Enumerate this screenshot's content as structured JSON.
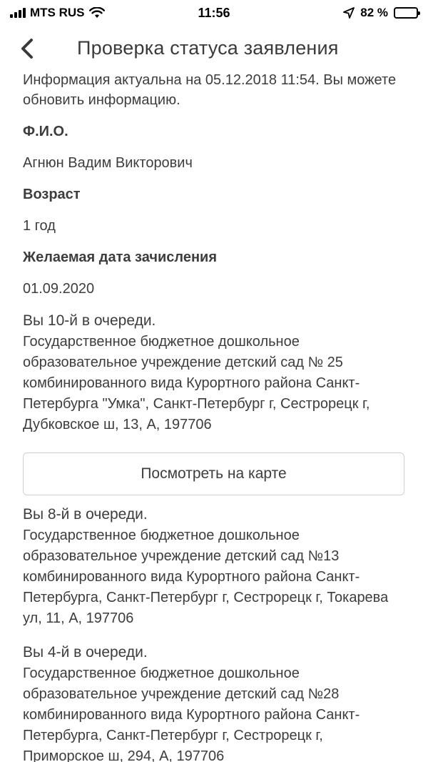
{
  "status_bar": {
    "carrier": "MTS RUS",
    "time": "11:56",
    "battery_percent": "82 %",
    "battery_level": 0.82
  },
  "header": {
    "title": "Проверка статуса заявления"
  },
  "info": {
    "text": "Информация актуальна на 05.12.2018 11:54. Вы можете обновить информацию."
  },
  "fields": [
    {
      "label": "Ф.И.О.",
      "value": "Агнюн Вадим Викторович"
    },
    {
      "label": "Возраст",
      "value": "1 год"
    },
    {
      "label": "Желаемая дата зачисления",
      "value": "01.09.2020"
    }
  ],
  "queues": [
    {
      "position": "Вы 10-й в очереди.",
      "organization": "Государственное бюджетное дошкольное образовательное учреждение детский сад № 25 комбинированного вида Курортного района Санкт-Петербурга \"Умка\", Санкт-Петербург г, Сестрорецк г, Дубковское ш, 13, А, 197706"
    },
    {
      "position": "Вы 8-й в очереди.",
      "organization": "Государственное бюджетное дошкольное образовательное учреждение детский сад №13 комбинированного вида Курортного района Санкт-Петербурга, Санкт-Петербург г, Сестрорецк г, Токарева ул, 11, А, 197706"
    },
    {
      "position": "Вы 4-й в очереди.",
      "organization": "Государственное бюджетное дошкольное образовательное учреждение детский сад №28 комбинированного вида Курортного района Санкт-Петербурга, Санкт-Петербург г, Сестрорецк г, Приморское ш, 294, А, 197706"
    }
  ],
  "map_button": {
    "label": "Посмотреть на карте"
  },
  "icons": {
    "back": "chevron-left-icon",
    "wifi": "wifi-icon",
    "location": "location-arrow-icon",
    "battery": "battery-icon",
    "signal": "signal-bars-icon"
  }
}
